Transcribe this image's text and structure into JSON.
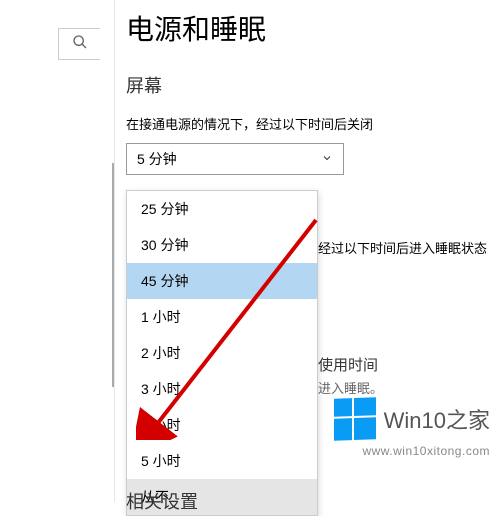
{
  "sidebar": {
    "search_placeholder": ""
  },
  "main": {
    "page_title": "电源和睡眠",
    "section_title": "屏幕",
    "screen_timeout_label": "在接通电源的情况下，经过以下时间后关闭",
    "screen_timeout_value": "5 分钟",
    "sleep_label_partial": "经过以下时间后进入睡眠状态",
    "usage_time_title": "使用时间",
    "usage_time_hint": "进入睡眠。",
    "related_title": "相关设置"
  },
  "dropdown": {
    "options": [
      "25 分钟",
      "30 分钟",
      "45 分钟",
      "1 小时",
      "2 小时",
      "3 小时",
      "4 小时",
      "5 小时",
      "从不"
    ],
    "highlighted_index": 2,
    "hover_index": 8
  },
  "watermark": {
    "text": "Win10之家",
    "url": "www.win10xitong.com"
  }
}
